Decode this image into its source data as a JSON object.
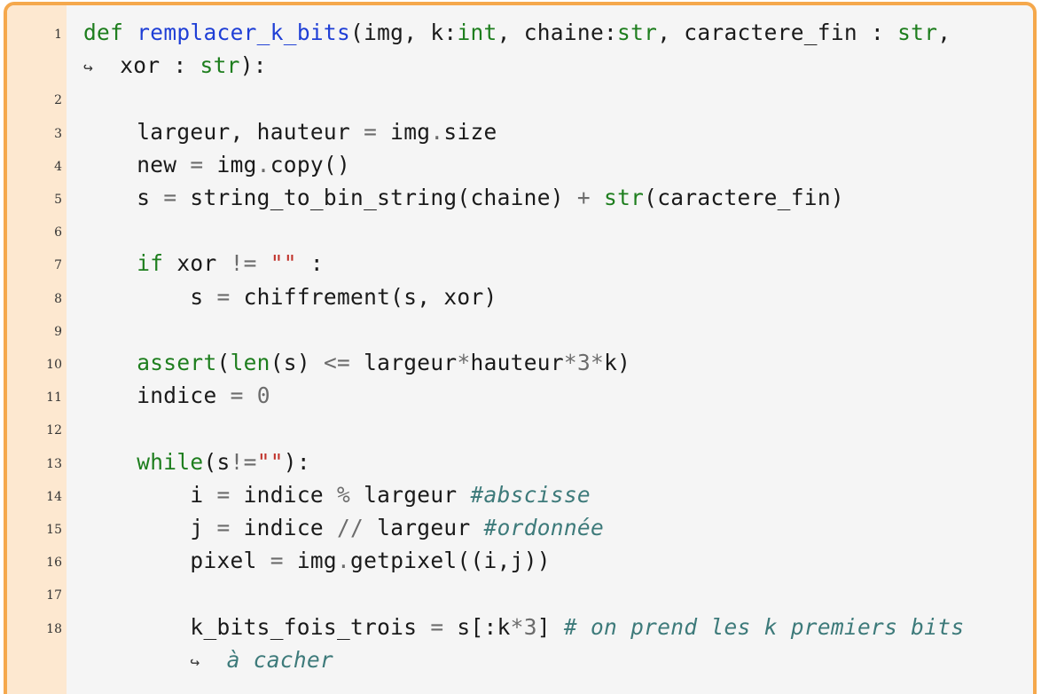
{
  "document": {
    "language": "python",
    "lines": [
      {
        "n": "1",
        "code": "def remplacer_k_bits(img, k:int, chaine:str, caractere_fin : str,"
      },
      {
        "n": "",
        "code": "xor : str):"
      },
      {
        "n": "2",
        "code": ""
      },
      {
        "n": "3",
        "code": "    largeur, hauteur = img.size"
      },
      {
        "n": "4",
        "code": "    new = img.copy()"
      },
      {
        "n": "5",
        "code": "    s = string_to_bin_string(chaine) + str(caractere_fin)"
      },
      {
        "n": "6",
        "code": ""
      },
      {
        "n": "7",
        "code": "    if xor != \"\" :"
      },
      {
        "n": "8",
        "code": "        s = chiffrement(s, xor)"
      },
      {
        "n": "9",
        "code": ""
      },
      {
        "n": "10",
        "code": "    assert(len(s) <= largeur*hauteur*3*k)"
      },
      {
        "n": "11",
        "code": "    indice = 0"
      },
      {
        "n": "12",
        "code": ""
      },
      {
        "n": "13",
        "code": "    while(s!=\"\"):"
      },
      {
        "n": "14",
        "code": "        i = indice % largeur #abscisse"
      },
      {
        "n": "15",
        "code": "        j = indice // largeur #ordonnée"
      },
      {
        "n": "16",
        "code": "        pixel = img.getpixel((i,j))"
      },
      {
        "n": "17",
        "code": ""
      },
      {
        "n": "18",
        "code": "        k_bits_fois_trois = s[:k*3] # on prend les k premiers bits"
      },
      {
        "n": "",
        "code": "à cacher"
      }
    ],
    "continuation_glyph": "↪"
  },
  "colors": {
    "frame_border": "#f5a84c",
    "gutter_bg": "#fde8d0",
    "code_bg": "#f5f5f5",
    "keyword": "#1e7e1e",
    "function_name": "#1f3fd6",
    "string": "#c0322b",
    "comment": "#3d7a7a",
    "operator": "#6c6c6c"
  }
}
